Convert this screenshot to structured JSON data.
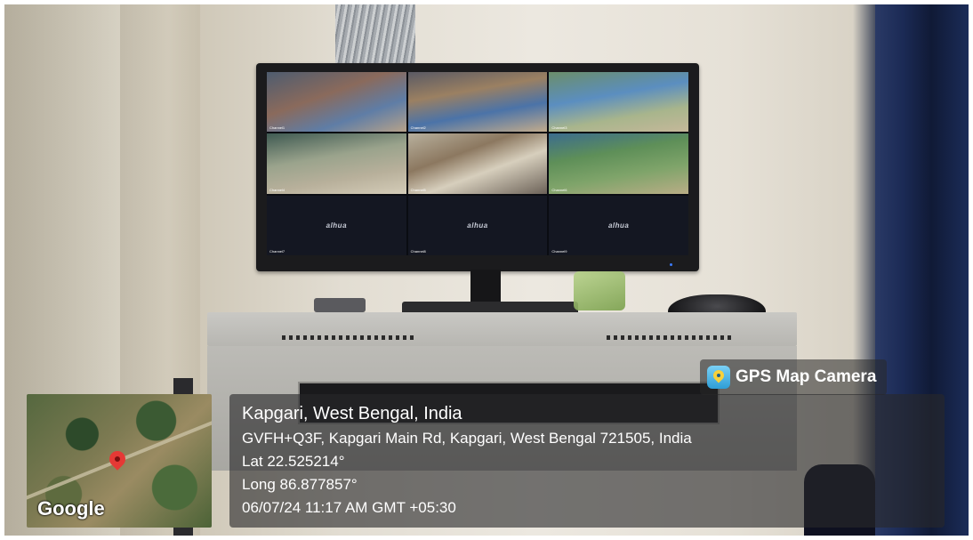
{
  "cctv": {
    "brand": "alhua",
    "cameras": [
      {
        "label": "Channel1"
      },
      {
        "label": "Channel2"
      },
      {
        "label": "Channel3"
      },
      {
        "label": "Channel4"
      },
      {
        "label": "Channel5"
      },
      {
        "label": "Channel6"
      },
      {
        "label": "Channel7"
      },
      {
        "label": "Channel8"
      },
      {
        "label": "Channel9"
      }
    ]
  },
  "gps_overlay": {
    "app_name": "GPS Map Camera",
    "map_provider": "Google",
    "location_title": "Kapgari, West Bengal, India",
    "address": "GVFH+Q3F, Kapgari Main Rd, Kapgari, West Bengal 721505, India",
    "latitude": "Lat 22.525214°",
    "longitude": "Long 86.877857°",
    "datetime": "06/07/24 11:17 AM GMT +05:30"
  }
}
